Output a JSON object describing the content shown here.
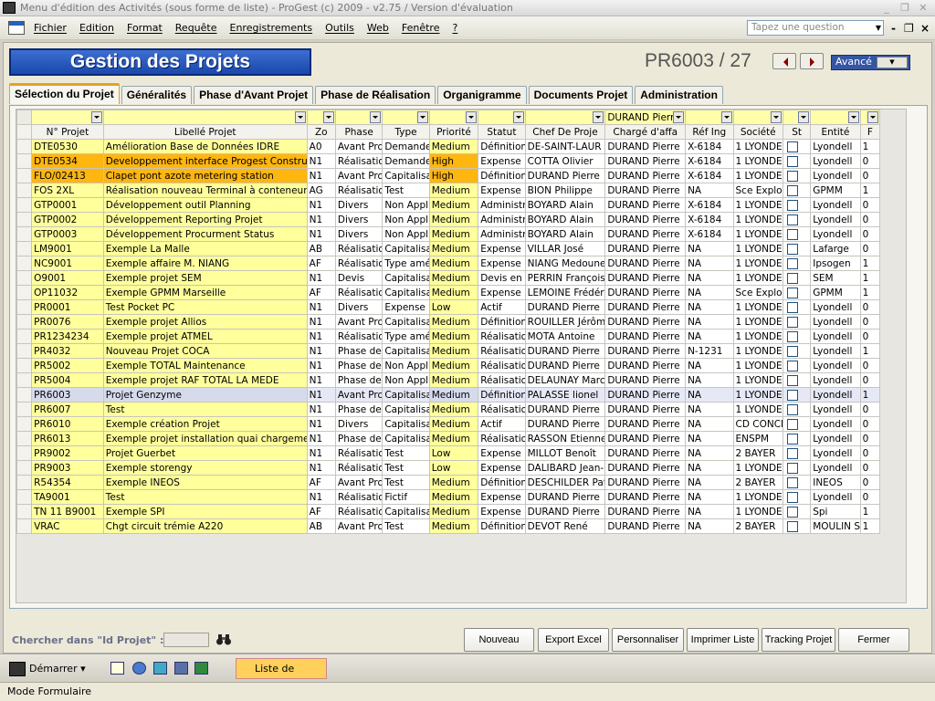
{
  "window": {
    "title": "Menu d'édition des Activités (sous forme de liste) - ProGest (c) 2009 - v2.75 / Version d'évaluation"
  },
  "menu": [
    "Fichier",
    "Edition",
    "Format",
    "Requête",
    "Enregistrements",
    "Outils",
    "Web",
    "Fenêtre",
    "?"
  ],
  "help_box": {
    "placeholder": "Tapez une question"
  },
  "form": {
    "title": "Gestion des Projets",
    "record": "PR6003 / 27",
    "advanced": "Avancé",
    "tabs": [
      "Sélection du Projet",
      "Généralités",
      "Phase d'Avant Projet",
      "Phase de Réalisation",
      "Organigramme",
      "Documents Projet",
      "Administration"
    ],
    "active_tab": "Sélection du Projet"
  },
  "grid": {
    "filter_values": [
      "",
      "",
      "",
      "",
      "",
      "",
      "",
      "",
      "",
      "DURAND Pierre",
      "",
      "",
      "",
      "",
      ""
    ],
    "columns": [
      "N° Projet",
      "Libellé Projet",
      "Zo",
      "Phase",
      "Type",
      "Priorité",
      "Statut",
      "Chef De Proje",
      "Chargé d'affa",
      "Réf Ing",
      "Société",
      "St",
      "Entité",
      "F"
    ],
    "rows": [
      [
        "DTE0530",
        "Amélioration Base de Données IDRE",
        "A0",
        "Avant Pro",
        "Demande",
        "Medium",
        "Définition",
        "DE-SAINT-LAUR",
        "DURAND Pierre",
        "X-6184",
        "1 LYONDE",
        "",
        "Lyondell",
        "1"
      ],
      [
        "DTE0534",
        "Developpement interface Progest Construction",
        "N1",
        "Réalisatio",
        "Demande",
        "High",
        "Expense I",
        "COTTA Olivier",
        "DURAND Pierre",
        "X-6184",
        "1 LYONDE",
        "",
        "Lyondell",
        "0"
      ],
      [
        "FLO/02413",
        "Clapet pont azote metering station",
        "N1",
        "Avant Pro",
        "Capitalisa",
        "High",
        "Définition",
        "DURAND Pierre",
        "DURAND Pierre",
        "X-6184",
        "1 LYONDE",
        "",
        "Lyondell",
        "0"
      ],
      [
        "FOS 2XL",
        "Réalisation nouveau Terminal à conteneurs",
        "AG",
        "Réalisatio",
        "Test",
        "Medium",
        "Expense I",
        "BION Philippe",
        "DURAND Pierre",
        "NA",
        "Sce Exploi",
        "",
        "GPMM",
        "1"
      ],
      [
        "GTP0001",
        "Développement outil Planning",
        "N1",
        "Divers",
        "Non Appli",
        "Medium",
        "Administra",
        "BOYARD Alain",
        "DURAND Pierre",
        "X-6184",
        "1 LYONDE",
        "",
        "Lyondell",
        "0"
      ],
      [
        "GTP0002",
        "Développement Reporting Projet",
        "N1",
        "Divers",
        "Non Appli",
        "Medium",
        "Administra",
        "BOYARD Alain",
        "DURAND Pierre",
        "X-6184",
        "1 LYONDE",
        "",
        "Lyondell",
        "0"
      ],
      [
        "GTP0003",
        "Développement Procurment Status",
        "N1",
        "Divers",
        "Non Appli",
        "Medium",
        "Administra",
        "BOYARD Alain",
        "DURAND Pierre",
        "X-6184",
        "1 LYONDE",
        "",
        "Lyondell",
        "0"
      ],
      [
        "LM9001",
        "Exemple La Malle",
        "AB",
        "Réalisatio",
        "Capitalisa",
        "Medium",
        "Expense I",
        "VILLAR José",
        "DURAND Pierre",
        "NA",
        "1 LYONDE",
        "",
        "Lafarge",
        "0"
      ],
      [
        "NC9001",
        "Exemple affaire M. NIANG",
        "AF",
        "Réalisatio",
        "Type amé",
        "Medium",
        "Expense I",
        "NIANG Medoune",
        "DURAND Pierre",
        "NA",
        "1 LYONDE",
        "",
        "Ipsogen",
        "1"
      ],
      [
        "O9001",
        "Exemple projet SEM",
        "N1",
        "Devis",
        "Capitalisa",
        "Medium",
        "Devis en e",
        "PERRIN François",
        "DURAND Pierre",
        "NA",
        "1 LYONDE",
        "",
        "SEM",
        "1"
      ],
      [
        "OP11032",
        "Exemple GPMM Marseille",
        "AF",
        "Réalisatio",
        "Capitalisa",
        "Medium",
        "Expense I",
        "LEMOINE Frédéric",
        "DURAND Pierre",
        "NA",
        "Sce Exploi",
        "",
        "GPMM",
        "1"
      ],
      [
        "PR0001",
        "Test Pocket PC",
        "N1",
        "Divers",
        "Expense",
        "Low",
        "Actif",
        "DURAND Pierre",
        "DURAND Pierre",
        "NA",
        "1 LYONDE",
        "",
        "Lyondell",
        "0"
      ],
      [
        "PR0076",
        "Exemple projet Allios",
        "N1",
        "Avant Pro",
        "Capitalisa",
        "Medium",
        "Définition",
        "ROUILLER Jérôme",
        "DURAND Pierre",
        "NA",
        "1 LYONDE",
        "",
        "Lyondell",
        "0"
      ],
      [
        "PR1234234",
        "Exemple projet ATMEL",
        "N1",
        "Réalisatio",
        "Type amé",
        "Medium",
        "Réalisatio",
        "MOTA Antoine",
        "DURAND Pierre",
        "NA",
        "1 LYONDE",
        "",
        "Lyondell",
        "0"
      ],
      [
        "PR4032",
        "Nouveau Projet COCA",
        "N1",
        "Phase de",
        "Capitalisa",
        "Medium",
        "Réalisatio",
        "DURAND Pierre",
        "DURAND Pierre",
        "N-1231",
        "1 LYONDE",
        "",
        "Lyondell",
        "1"
      ],
      [
        "PR5002",
        "Exemple TOTAL Maintenance",
        "N1",
        "Phase de",
        "Non Appli",
        "Medium",
        "Réalisatio",
        "DURAND Pierre",
        "DURAND Pierre",
        "NA",
        "1 LYONDE",
        "",
        "Lyondell",
        "0"
      ],
      [
        "PR5004",
        "Exemple projet RAF TOTAL LA MEDE",
        "N1",
        "Phase de",
        "Non Appli",
        "Medium",
        "Réalisatio",
        "DELAUNAY Marc",
        "DURAND Pierre",
        "NA",
        "1 LYONDE",
        "",
        "Lyondell",
        "0"
      ],
      [
        "PR6003",
        "Projet Genzyme",
        "N1",
        "Avant Pro",
        "Capitalisa",
        "Medium",
        "Définition",
        "PALASSE lionel",
        "DURAND Pierre",
        "NA",
        "1 LYONDE",
        "",
        "Lyondell",
        "1"
      ],
      [
        "PR6007",
        "Test",
        "N1",
        "Phase de",
        "Capitalisa",
        "Medium",
        "Réalisatio",
        "DURAND Pierre",
        "DURAND Pierre",
        "NA",
        "1 LYONDE",
        "",
        "Lyondell",
        "0"
      ],
      [
        "PR6010",
        "Exemple création Projet",
        "N1",
        "Divers",
        "Capitalisa",
        "Medium",
        "Actif",
        "DURAND Pierre",
        "DURAND Pierre",
        "NA",
        "CD CONCE",
        "",
        "Lyondell",
        "0"
      ],
      [
        "PR6013",
        "Exemple projet installation quai chargement c",
        "N1",
        "Phase de",
        "Capitalisa",
        "Medium",
        "Réalisatio",
        "RASSON Etienne",
        "DURAND Pierre",
        "NA",
        "ENSPM",
        "",
        "Lyondell",
        "0"
      ],
      [
        "PR9002",
        "Projet Guerbet",
        "N1",
        "Réalisatio",
        "Test",
        "Low",
        "Expense I",
        "MILLOT Benoît",
        "DURAND Pierre",
        "NA",
        "2 BAYER",
        "",
        "Lyondell",
        "0"
      ],
      [
        "PR9003",
        "Exemple storengy",
        "N1",
        "Réalisatio",
        "Test",
        "Low",
        "Expense I",
        "DALIBARD Jean-",
        "DURAND Pierre",
        "NA",
        "1 LYONDE",
        "",
        "Lyondell",
        "0"
      ],
      [
        "R54354",
        "Exemple INEOS",
        "AF",
        "Avant Pro",
        "Test",
        "Medium",
        "Définition",
        "DESCHILDER Patr",
        "DURAND Pierre",
        "NA",
        "2 BAYER",
        "",
        "INEOS",
        "0"
      ],
      [
        "TA9001",
        "Test",
        "N1",
        "Réalisatio",
        "Fictif",
        "Medium",
        "Expense I",
        "DURAND Pierre",
        "DURAND Pierre",
        "NA",
        "1 LYONDE",
        "",
        "Lyondell",
        "0"
      ],
      [
        "TN 11 B9001",
        "Exemple SPI",
        "AF",
        "Réalisatio",
        "Capitalisa",
        "Medium",
        "Expense I",
        "DURAND Pierre",
        "DURAND Pierre",
        "NA",
        "1 LYONDE",
        "",
        "Spi",
        "1"
      ],
      [
        "VRAC",
        "Chgt circuit trémie A220",
        "AB",
        "Avant Pro",
        "Test",
        "Medium",
        "Définition",
        "DEVOT René",
        "DURAND Pierre",
        "NA",
        "2 BAYER",
        "",
        "MOULIN S",
        "1"
      ]
    ]
  },
  "search": {
    "label": "Chercher dans \"Id Projet\" :"
  },
  "buttons": [
    "Nouveau",
    "Export Excel",
    "Personnaliser",
    "Imprimer Liste",
    "Tracking Projet",
    "Fermer"
  ],
  "taskbar": {
    "start": "Démarrer",
    "item": "Liste de Projet"
  },
  "status": "Mode Formulaire",
  "colors": {
    "highlight": "#ffff9c",
    "priority_high": "#ffb60f",
    "title_bg": "#2a58be"
  }
}
